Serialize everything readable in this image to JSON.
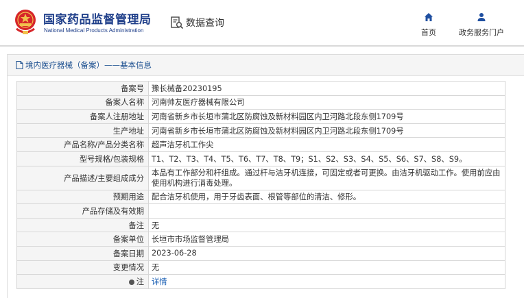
{
  "header": {
    "agency_cn": "国家药品监督管理局",
    "agency_en": "National Medical Products Administration",
    "data_query_label": "数据查询",
    "nav": [
      {
        "label": "首页",
        "icon": "home-icon"
      },
      {
        "label": "政务服务门户",
        "icon": "user-icon"
      }
    ],
    "brand_color": "#1f3f8a"
  },
  "panel": {
    "title": "境内医疗器械（备案）——基本信息",
    "rows": [
      {
        "label": "备案号",
        "value": "豫长械备20230195"
      },
      {
        "label": "备案人名称",
        "value": "河南帅友医疗器械有限公司"
      },
      {
        "label": "备案人注册地址",
        "value": "河南省新乡市长垣市蒲北区防腐蚀及新材料园区内卫河路北段东侧1709号"
      },
      {
        "label": "生产地址",
        "value": "河南省新乡市长垣市蒲北区防腐蚀及新材料园区内卫河路北段东侧1709号"
      },
      {
        "label": "产品名称/产品分类名称",
        "value": "超声洁牙机工作尖"
      },
      {
        "label": "型号规格/包装规格",
        "value": "T1、T2、T3、T4、T5、T6、T7、T8、T9；S1、S2、S3、S4、S5、S6、S7、S8、S9。"
      },
      {
        "label": "产品描述/主要组成成分",
        "value": "本品有工作部分和杆组成。通过杆与洁牙机连接，可固定或者可更换。由洁牙机驱动工作。使用前应由使用机构进行消毒处理。"
      },
      {
        "label": "预期用途",
        "value": "配合洁牙机使用，用于牙齿表面、根管等部位的清洁、修形。"
      },
      {
        "label": "产品存储及有效期",
        "value": ""
      },
      {
        "label": "备注",
        "value": "无"
      },
      {
        "label": "备案单位",
        "value": "长垣市市场监督管理局"
      },
      {
        "label": "备案日期",
        "value": "2023-06-28"
      },
      {
        "label": "变更情况",
        "value": "无"
      },
      {
        "label": "注",
        "value": "详情",
        "link": true
      }
    ]
  }
}
